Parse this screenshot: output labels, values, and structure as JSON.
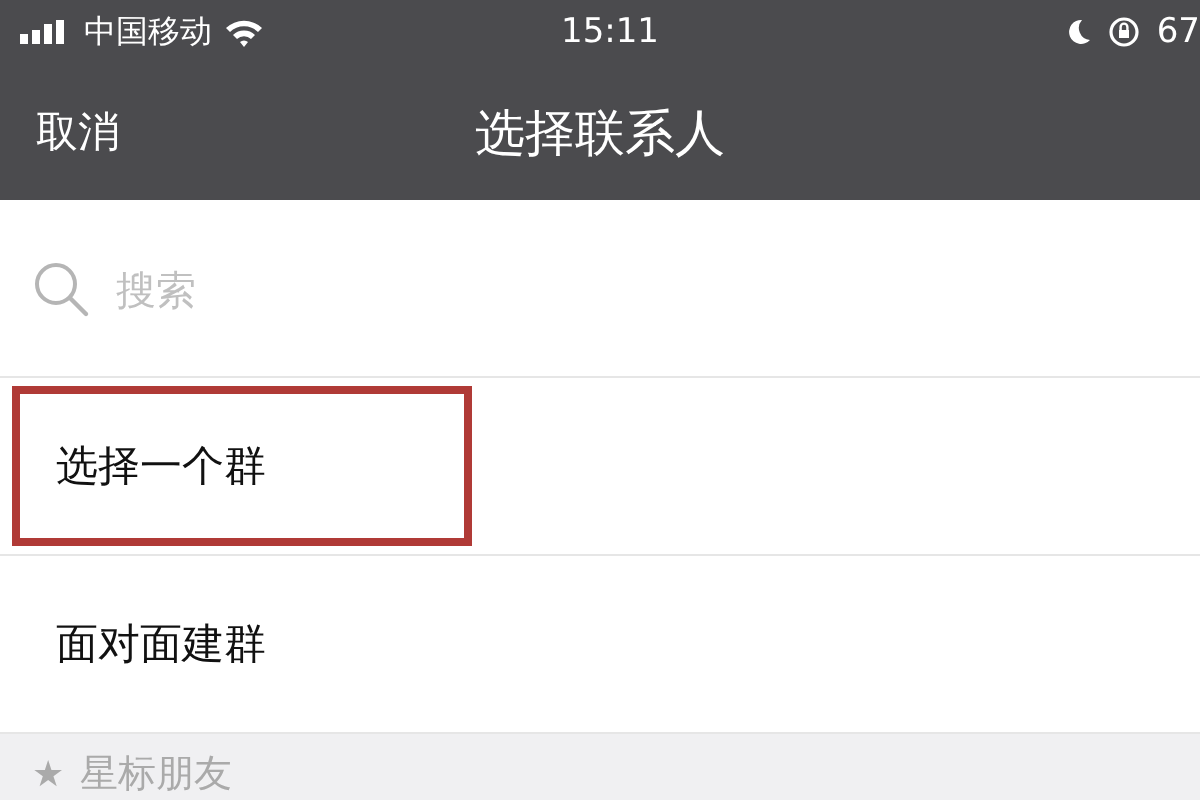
{
  "status_bar": {
    "carrier": "中国移动",
    "time": "15:11",
    "battery": "67"
  },
  "nav_bar": {
    "cancel": "取消",
    "title": "选择联系人"
  },
  "search": {
    "placeholder": "搜索"
  },
  "items": [
    {
      "label": "选择一个群",
      "highlighted": true
    },
    {
      "label": "面对面建群",
      "highlighted": false
    }
  ],
  "section_header": {
    "icon": "★",
    "label": "星标朋友"
  }
}
